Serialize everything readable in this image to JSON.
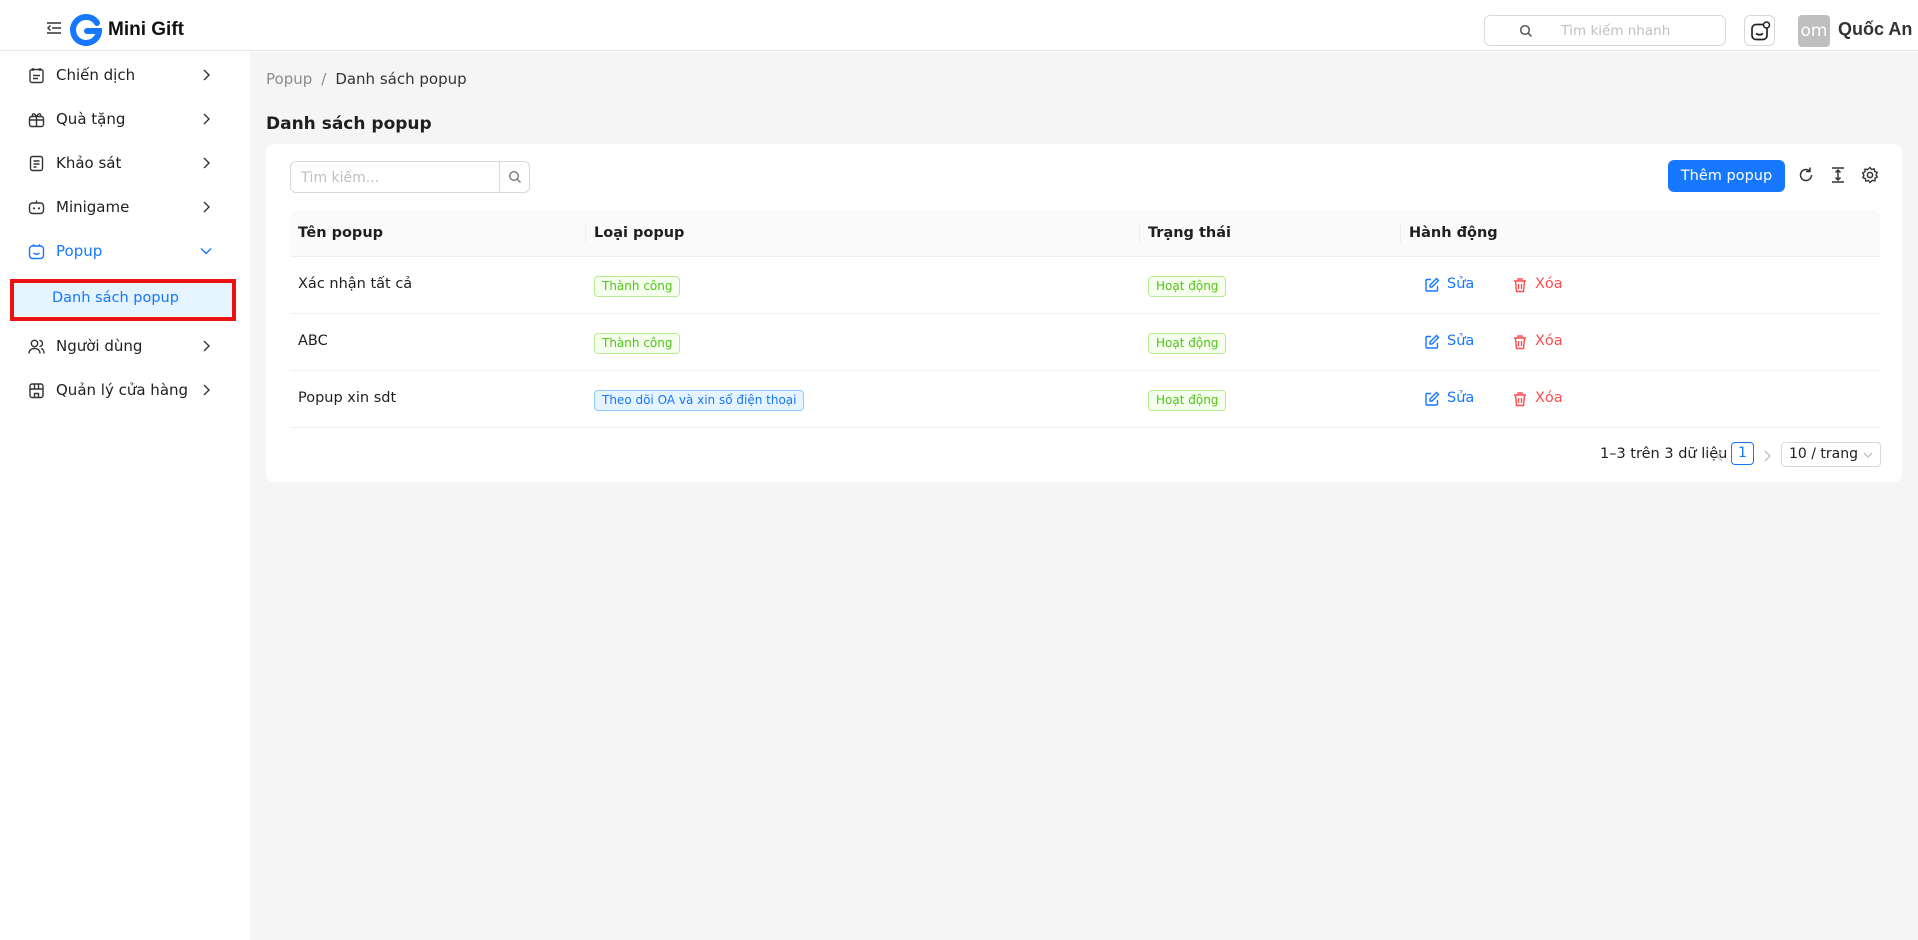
{
  "app": {
    "brand": "Mini Gift"
  },
  "header": {
    "search_placeholder": "Tìm kiếm nhanh",
    "avatar_text": "om",
    "user_name": "Quốc An"
  },
  "sidebar": {
    "items": [
      {
        "label": "Chiến dịch",
        "icon": "campaign-icon"
      },
      {
        "label": "Quà tặng",
        "icon": "gift-icon"
      },
      {
        "label": "Khảo sát",
        "icon": "survey-icon"
      },
      {
        "label": "Minigame",
        "icon": "game-icon"
      },
      {
        "label": "Popup",
        "icon": "popup-icon"
      },
      {
        "label": "Người dùng",
        "icon": "users-icon"
      },
      {
        "label": "Quản lý cửa hàng",
        "icon": "store-icon"
      }
    ],
    "sub_items": [
      {
        "label": "Danh sách popup"
      }
    ]
  },
  "breadcrumb": {
    "parent": "Popup",
    "separator": "/",
    "current": "Danh sách popup"
  },
  "page": {
    "title": "Danh sách popup"
  },
  "toolbar": {
    "search_placeholder": "Tìm kiếm...",
    "add_label": "Thêm popup"
  },
  "table": {
    "columns": [
      "Tên popup",
      "Loại popup",
      "Trạng thái",
      "Hành động"
    ],
    "rows": [
      {
        "name": "Xác nhận tất cả",
        "type": "Thành công",
        "status": "Hoạt động",
        "edit": "Sửa",
        "delete": "Xóa"
      },
      {
        "name": "ABC",
        "type": "Thành công",
        "status": "Hoạt động",
        "edit": "Sửa",
        "delete": "Xóa"
      },
      {
        "name": "Popup xin sdt",
        "type": "Theo dõi OA và xin số điện thoại",
        "status": "Hoạt động",
        "edit": "Sửa",
        "delete": "Xóa"
      }
    ]
  },
  "pagination": {
    "total_text": "1–3 trên 3 dữ liệu",
    "current_page": "1",
    "page_size": "10 / trang"
  },
  "colors": {
    "primary": "#1677ff",
    "success": "#52c41a",
    "danger": "#ff4d4f",
    "annotation": "#e11111"
  }
}
